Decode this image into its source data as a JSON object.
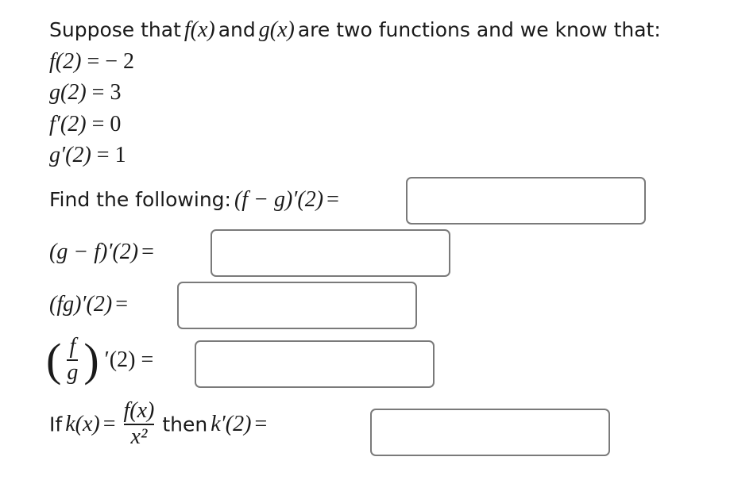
{
  "intro": {
    "text_before": "Suppose that",
    "f_of_x": "f(x)",
    "and": "and",
    "g_of_x": "g(x)",
    "text_after": "are two functions and we know that:"
  },
  "givens": [
    {
      "lhs": "f(2)",
      "rhs": "= − 2"
    },
    {
      "lhs": "g(2)",
      "rhs": "= 3"
    },
    {
      "lhs": "f′(2)",
      "rhs": "= 0"
    },
    {
      "lhs": "g′(2)",
      "rhs": "= 1"
    }
  ],
  "questions": {
    "find_label": "Find the following:",
    "q1": {
      "expr": "(f − g)′(2)",
      "eq": "=",
      "value": "",
      "placeholder": ""
    },
    "q2": {
      "expr": "(g − f)′(2)",
      "eq": "=",
      "value": "",
      "placeholder": ""
    },
    "q3": {
      "expr": "(fg)′(2)",
      "eq": "=",
      "value": "",
      "placeholder": ""
    },
    "q4": {
      "numerator": "f",
      "denominator": "g",
      "open": "(",
      "close": ")",
      "suffix": "′(2)",
      "eq": "=",
      "value": "",
      "placeholder": ""
    },
    "q5": {
      "if": "If",
      "k_of_x": "k(x)",
      "eq1": "=",
      "numerator": "f(x)",
      "denominator": "x²",
      "then": "then",
      "expr": "k′(2)",
      "eq": "=",
      "value": "",
      "placeholder": ""
    }
  }
}
